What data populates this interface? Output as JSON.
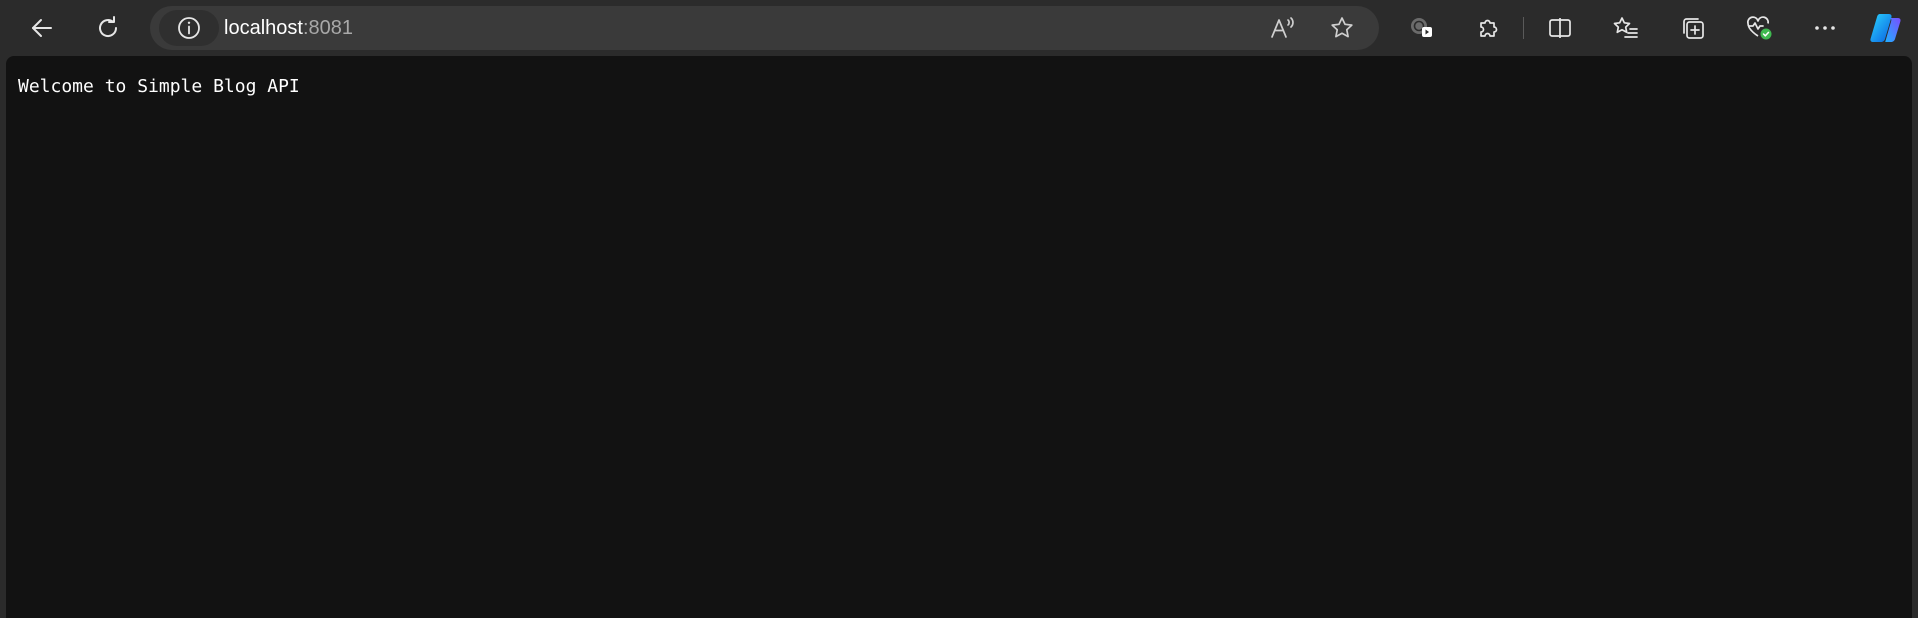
{
  "address_bar": {
    "host": "localhost",
    "port": ":8081"
  },
  "page": {
    "body_text": "Welcome to Simple Blog API"
  },
  "icons": {
    "back": "arrow-left-icon",
    "refresh": "refresh-icon",
    "site_info": "info-icon",
    "read_aloud": "read-aloud-icon",
    "favorite": "star-icon",
    "extension_badge": "extension-badge-icon",
    "extensions": "puzzle-icon",
    "split_screen": "split-screen-icon",
    "favorites": "favorites-list-icon",
    "collections": "collections-icon",
    "browser_essentials": "heart-pulse-icon",
    "more": "more-dots-icon",
    "copilot": "copilot-icon"
  },
  "colors": {
    "toolbar_bg": "#2b2b2b",
    "address_bg": "#3a3a3a",
    "content_bg": "#121212",
    "text": "#ffffff",
    "muted": "#a8a8a8",
    "status_green": "#3fb950"
  }
}
